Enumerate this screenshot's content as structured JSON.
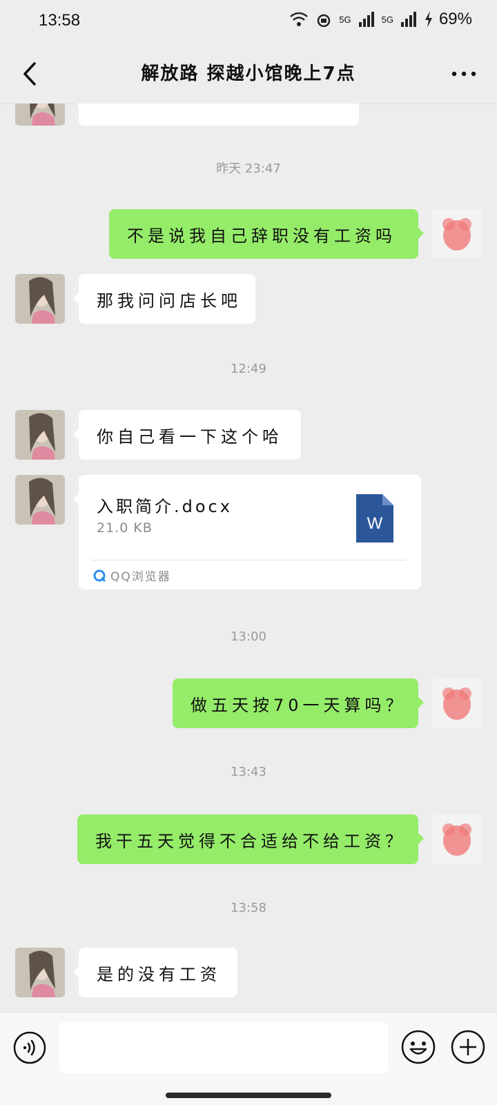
{
  "status_bar": {
    "time": "13:58",
    "battery": "69%",
    "network_1": "5G",
    "network_2": "5G"
  },
  "header": {
    "title": "解放路 探越小馆晚上7点"
  },
  "messages": [
    {
      "id": "m2",
      "side": "right",
      "text": "不是说我自己辞职没有工资吗"
    },
    {
      "id": "m3",
      "side": "left",
      "text": "那我问问店长吧"
    },
    {
      "id": "m4",
      "side": "left",
      "text": "你自己看一下这个哈"
    },
    {
      "id": "m6",
      "side": "right",
      "text": "做五天按70一天算吗？"
    },
    {
      "id": "m7",
      "side": "right",
      "text": "我干五天觉得不合适给不给工资？"
    },
    {
      "id": "m8",
      "side": "left",
      "text": "是的没有工资"
    }
  ],
  "timestamps": [
    "昨天 23:47",
    "12:49",
    "13:00",
    "13:43",
    "13:58"
  ],
  "file": {
    "name": "入职简介.docx",
    "size": "21.0 KB",
    "source": "QQ浏览器",
    "icon_letter": "W",
    "icon_color": "#2b579a"
  },
  "input": {
    "value": "",
    "placeholder": ""
  },
  "colors": {
    "background": "#ededed",
    "self_bubble": "#95ec69",
    "other_bubble": "#ffffff",
    "timestamp": "#9a9a9a"
  },
  "icons": {
    "back": "chevron-left-icon",
    "more": "more-dots-icon",
    "voice": "voice-icon",
    "emoji": "emoji-icon",
    "plus": "plus-icon",
    "file": "word-document-icon",
    "browser": "qq-browser-icon"
  }
}
